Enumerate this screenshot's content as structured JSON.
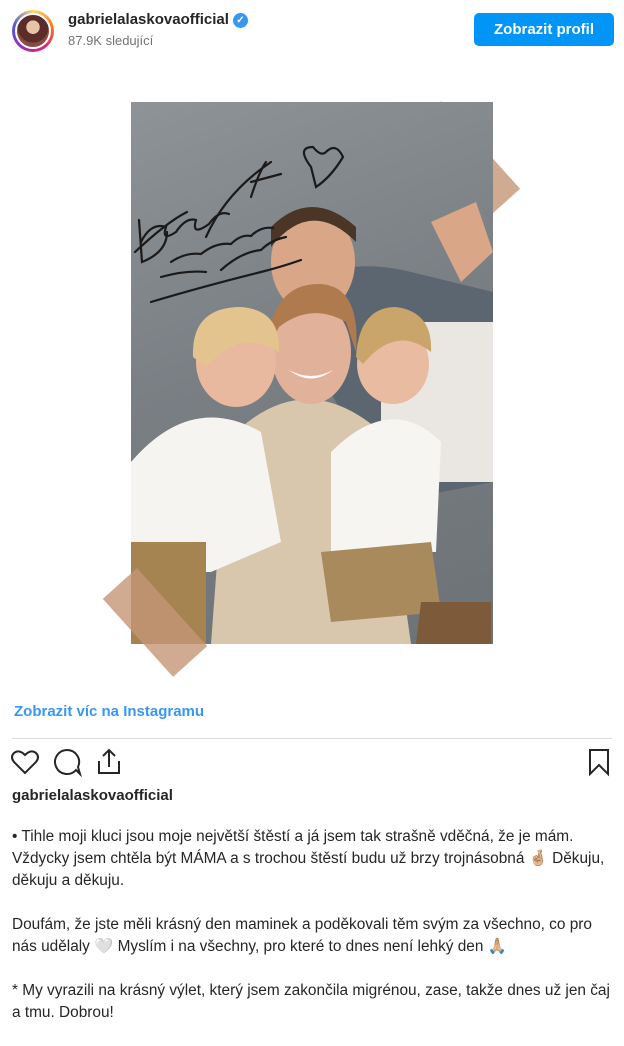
{
  "header": {
    "username": "gabrielalaskovaofficial",
    "verified_mark": "✓",
    "followers": "87.9K sledující",
    "profile_button": "Zobrazit profil"
  },
  "photo": {
    "handwritten_note": "Děkuju, že můžu být vaší MAMINKA"
  },
  "link_more": "Zobrazit víc na Instagramu",
  "actions": {
    "icons": [
      "heart-icon",
      "comment-icon",
      "share-icon",
      "bookmark-icon"
    ]
  },
  "caption": {
    "username": "gabrielalaskovaofficial",
    "paragraphs": [
      "• Tihle moji kluci jsou moje největší štěstí a já jsem tak strašně vděčná, že je mám. Vždycky jsem chtěla být MÁMA a s trochou štěstí budu už brzy trojnásobná 🤞🏼 Děkuju, děkuju a děkuju.",
      "Doufám, že jste měli krásný den maminek a poděkovali těm svým za všechno, co pro nás udělaly 🤍 Myslím i na všechny, pro které to dnes není lehký den 🙏🏼",
      "* My vyrazili na krásný výlet, který jsem zakončila migrénou, zase, takže dnes už jen čaj a tmu. Dobrou!"
    ]
  },
  "colors": {
    "accent": "#0095f6",
    "link": "#3897f0",
    "tape": "#c49676",
    "photo_bg": "#7d8286"
  }
}
